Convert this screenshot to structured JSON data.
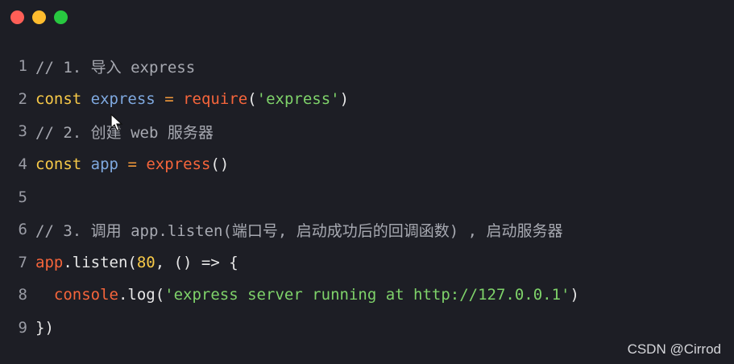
{
  "window": {
    "controls": [
      "close",
      "minimize",
      "maximize"
    ],
    "colors": {
      "close": "#ff5f57",
      "minimize": "#febc2e",
      "maximize": "#28c840"
    }
  },
  "code": {
    "lines": [
      {
        "n": "1",
        "tokens": [
          {
            "t": "// 1. 导入 express",
            "c": "cm"
          }
        ]
      },
      {
        "n": "2",
        "tokens": [
          {
            "t": "const",
            "c": "kw"
          },
          {
            "t": " ",
            "c": "plain"
          },
          {
            "t": "express",
            "c": "var"
          },
          {
            "t": " ",
            "c": "plain"
          },
          {
            "t": "=",
            "c": "op"
          },
          {
            "t": " ",
            "c": "plain"
          },
          {
            "t": "require",
            "c": "fn"
          },
          {
            "t": "(",
            "c": "plain"
          },
          {
            "t": "'express'",
            "c": "str"
          },
          {
            "t": ")",
            "c": "plain"
          }
        ]
      },
      {
        "n": "3",
        "tokens": [
          {
            "t": "// 2. 创建 web 服务器",
            "c": "cm"
          }
        ]
      },
      {
        "n": "4",
        "tokens": [
          {
            "t": "const",
            "c": "kw"
          },
          {
            "t": " ",
            "c": "plain"
          },
          {
            "t": "app",
            "c": "var"
          },
          {
            "t": " ",
            "c": "plain"
          },
          {
            "t": "=",
            "c": "op"
          },
          {
            "t": " ",
            "c": "plain"
          },
          {
            "t": "express",
            "c": "fn"
          },
          {
            "t": "()",
            "c": "plain"
          }
        ]
      },
      {
        "n": "5",
        "tokens": []
      },
      {
        "n": "6",
        "tokens": [
          {
            "t": "// 3. 调用 app.listen(端口号, 启动成功后的回调函数) , 启动服务器",
            "c": "cm"
          }
        ]
      },
      {
        "n": "7",
        "tokens": [
          {
            "t": "app",
            "c": "fn"
          },
          {
            "t": ".listen(",
            "c": "plain"
          },
          {
            "t": "80",
            "c": "num"
          },
          {
            "t": ", () => {",
            "c": "plain"
          }
        ]
      },
      {
        "n": "8",
        "tokens": [
          {
            "t": "  ",
            "c": "plain"
          },
          {
            "t": "console",
            "c": "fn"
          },
          {
            "t": ".log(",
            "c": "plain"
          },
          {
            "t": "'express server running at http://127.0.0.1'",
            "c": "str"
          },
          {
            "t": ")",
            "c": "plain"
          }
        ]
      },
      {
        "n": "9",
        "tokens": [
          {
            "t": "})",
            "c": "plain"
          }
        ]
      }
    ]
  },
  "watermark": "CSDN @Cirrod"
}
